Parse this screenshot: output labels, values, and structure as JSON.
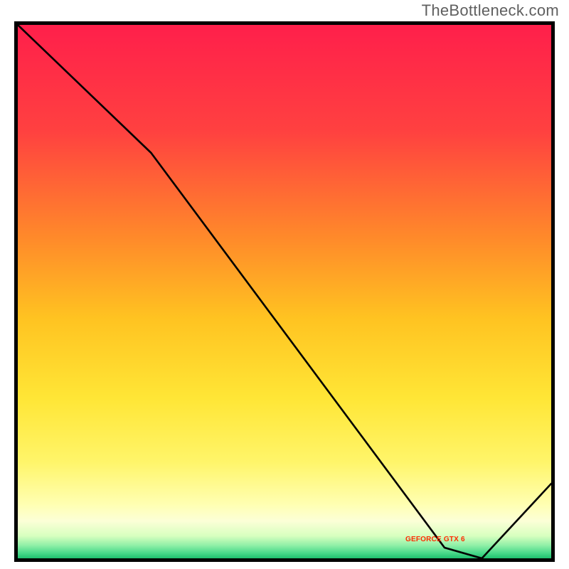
{
  "watermark": "TheBottleneck.com",
  "chart_data": {
    "type": "line",
    "title": "",
    "xlabel": "",
    "ylabel": "",
    "xlim": [
      0,
      100
    ],
    "ylim": [
      0,
      100
    ],
    "grid": false,
    "legend_position": "none",
    "series": [
      {
        "name": "bottleneck-curve",
        "label": "",
        "x": [
          0,
          25,
          80,
          87,
          100
        ],
        "values": [
          100,
          76,
          2,
          0,
          14
        ]
      }
    ],
    "background_gradient_stops": [
      {
        "offset": 0.0,
        "color": "#ff1f4b"
      },
      {
        "offset": 0.2,
        "color": "#ff4140"
      },
      {
        "offset": 0.4,
        "color": "#ff8a2a"
      },
      {
        "offset": 0.55,
        "color": "#ffc321"
      },
      {
        "offset": 0.7,
        "color": "#ffe636"
      },
      {
        "offset": 0.82,
        "color": "#fff56a"
      },
      {
        "offset": 0.9,
        "color": "#ffffb3"
      },
      {
        "offset": 0.93,
        "color": "#fcffd7"
      },
      {
        "offset": 0.958,
        "color": "#d7ffbf"
      },
      {
        "offset": 0.975,
        "color": "#93f0a8"
      },
      {
        "offset": 0.99,
        "color": "#49d98a"
      },
      {
        "offset": 1.0,
        "color": "#1fbf6e"
      }
    ],
    "series_label_text": "GEFORCE GTX 6",
    "series_label_pos_pct": {
      "x": 78,
      "y": 97
    }
  }
}
